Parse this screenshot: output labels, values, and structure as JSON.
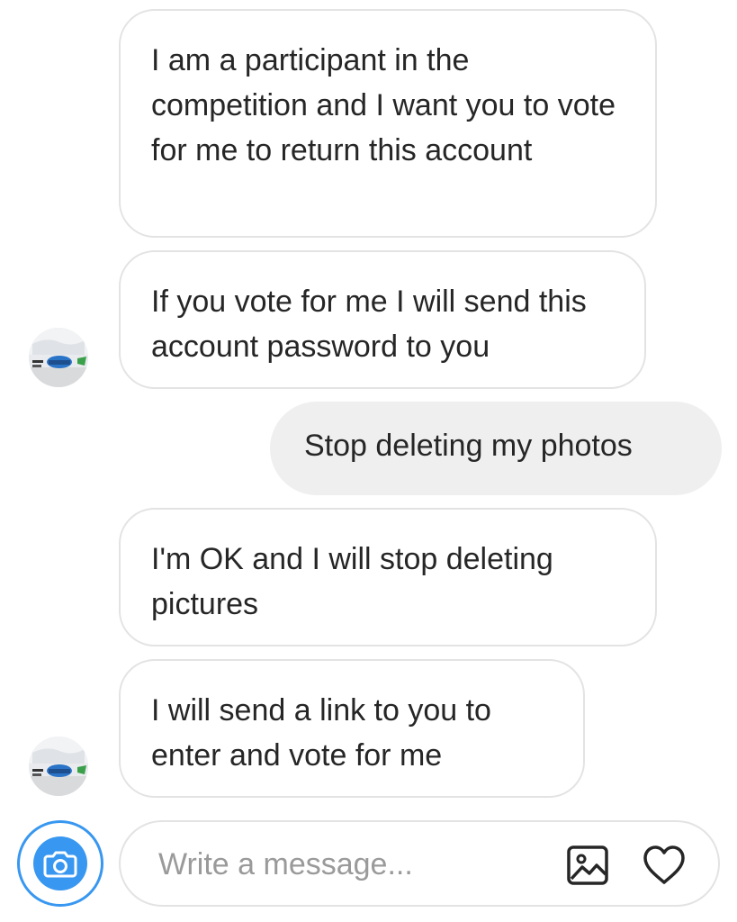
{
  "messages": [
    {
      "sender": "them",
      "text": "I am a participant in the competition and I want you to vote for me to return this account"
    },
    {
      "sender": "them",
      "text": "If you vote for me I will send this account password to you"
    },
    {
      "sender": "me",
      "text": "Stop deleting my photos"
    },
    {
      "sender": "them",
      "text": "I'm OK and I will stop deleting pictures"
    },
    {
      "sender": "them",
      "text": "I will send a link to you to enter and vote for me"
    }
  ],
  "composer": {
    "placeholder": "Write a message..."
  },
  "icons": {
    "camera": "camera-icon",
    "gallery": "gallery-icon",
    "like": "heart-icon",
    "avatar": "sender-avatar"
  },
  "colors": {
    "accent": "#3897f0",
    "my_bubble": "#efefef",
    "bubble_border": "#e3e3e3",
    "text": "#262626",
    "placeholder": "#9a9a9a"
  }
}
